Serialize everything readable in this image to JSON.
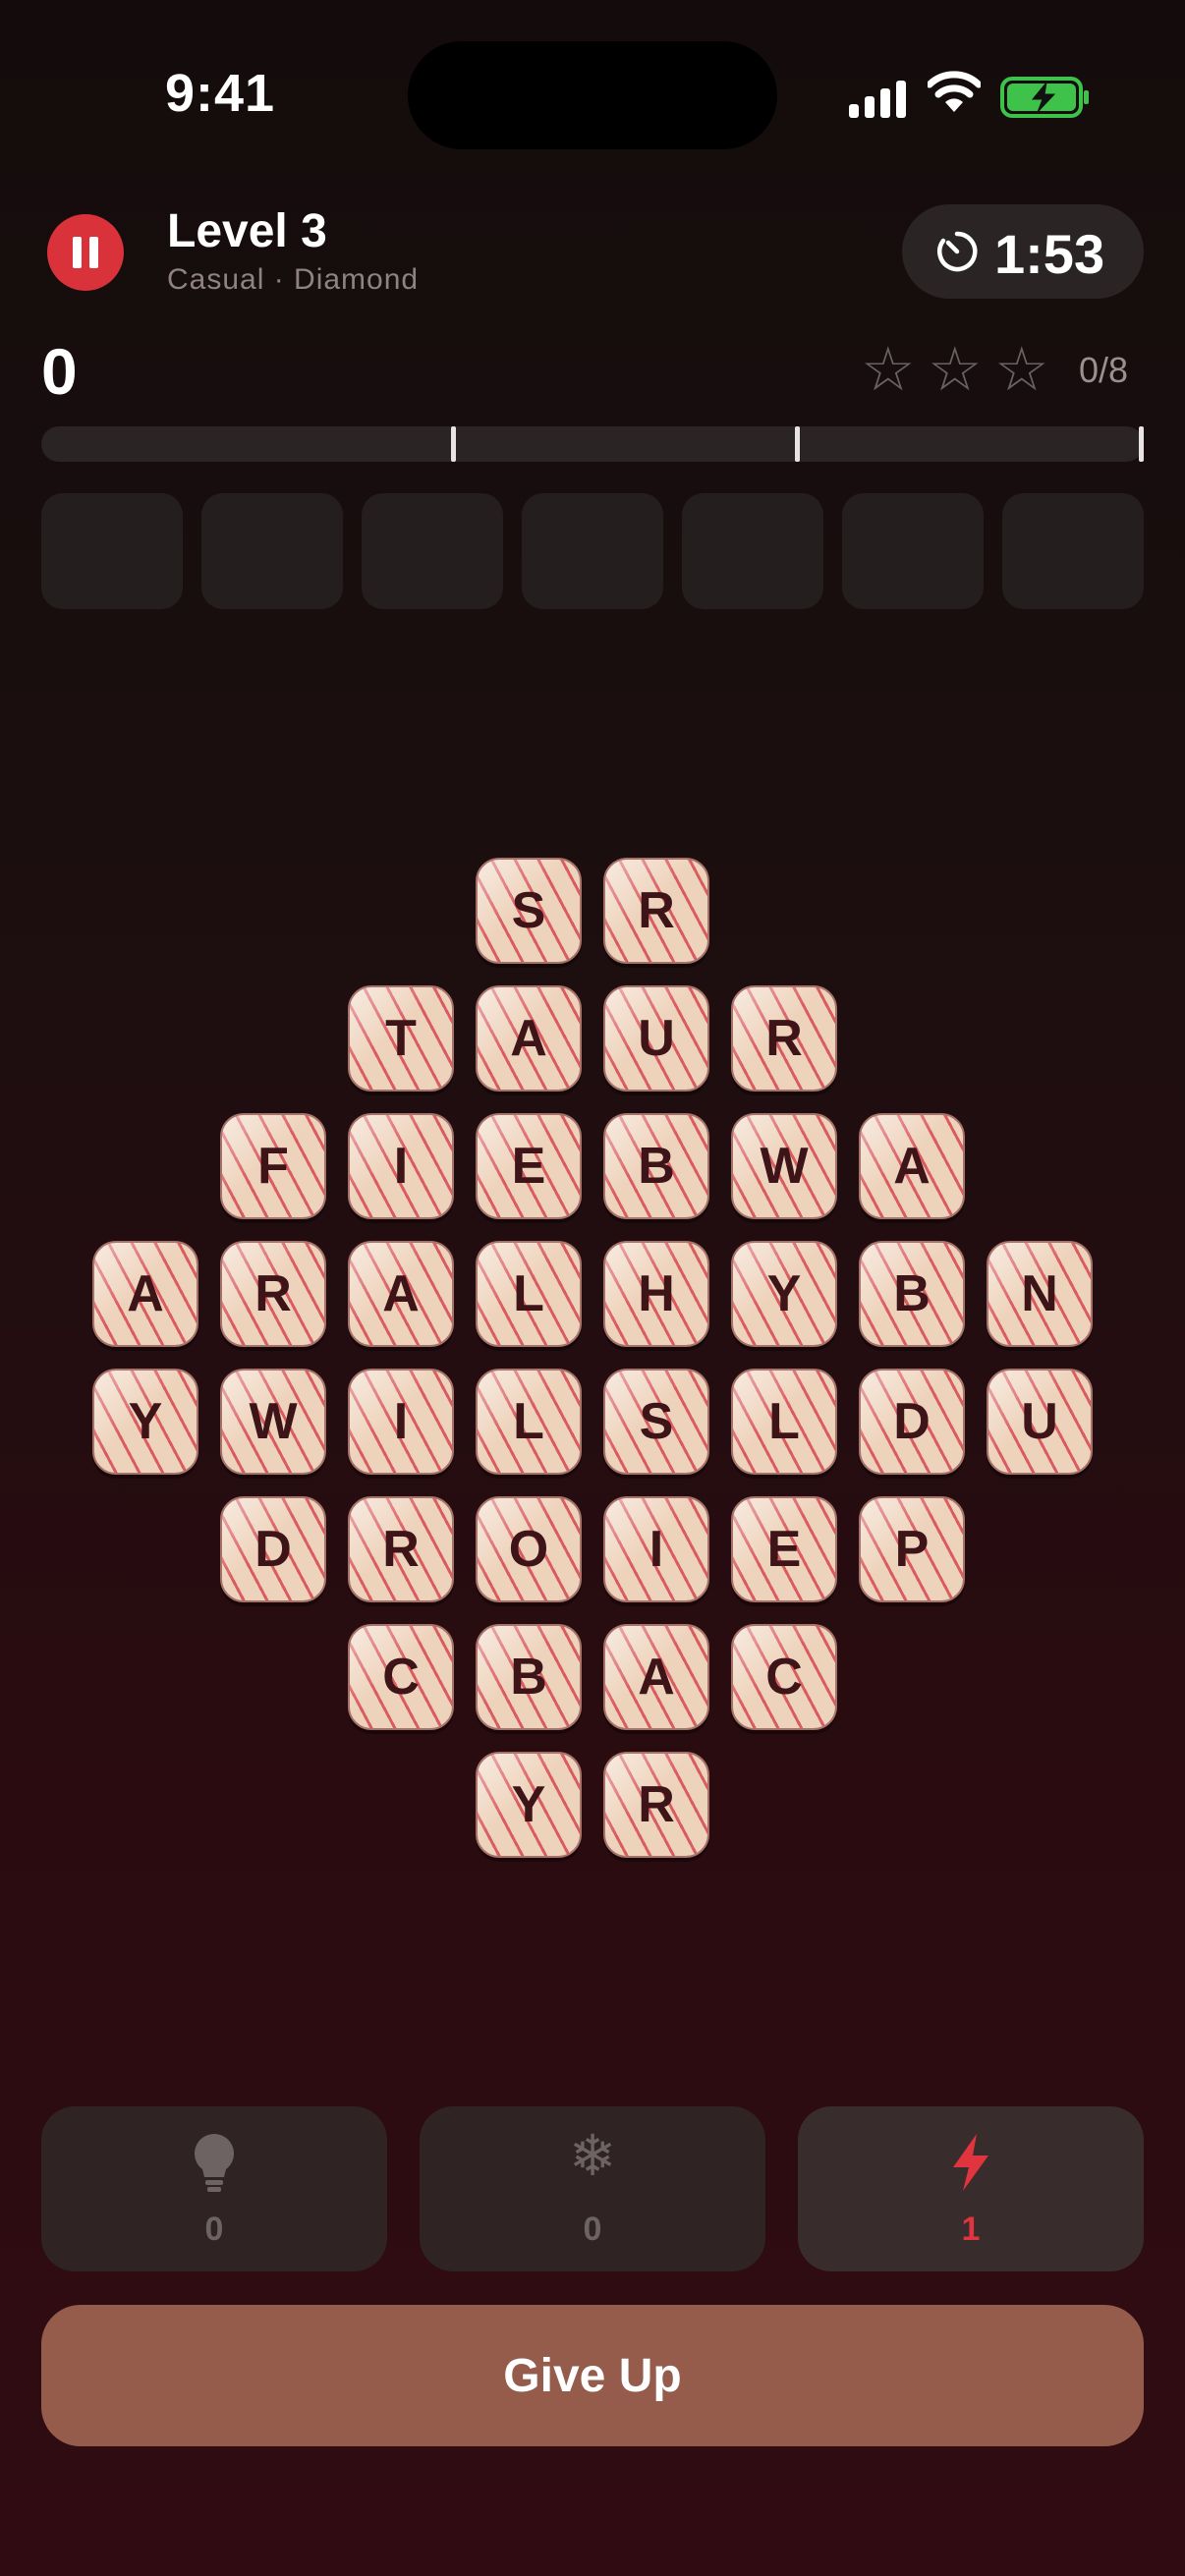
{
  "status_bar": {
    "time": "9:41"
  },
  "header": {
    "level_title": "Level 3",
    "subtitle": "Casual · Diamond",
    "timer": "1:53",
    "score": "0",
    "stars_count": "0/8",
    "stars_earned": 0,
    "stars_total": 3
  },
  "progress": {
    "value": 0
  },
  "word_slots": 7,
  "board": {
    "rows": [
      [
        "S",
        "R"
      ],
      [
        "T",
        "A",
        "U",
        "R"
      ],
      [
        "F",
        "I",
        "E",
        "B",
        "W",
        "A"
      ],
      [
        "A",
        "R",
        "A",
        "L",
        "H",
        "Y",
        "B",
        "N"
      ],
      [
        "Y",
        "W",
        "I",
        "L",
        "S",
        "L",
        "D",
        "U"
      ],
      [
        "D",
        "R",
        "O",
        "I",
        "E",
        "P"
      ],
      [
        "C",
        "B",
        "A",
        "C"
      ],
      [
        "Y",
        "R"
      ]
    ]
  },
  "powerups": {
    "hint": {
      "count": "0",
      "icon": "lightbulb-icon"
    },
    "freeze": {
      "count": "0",
      "icon": "snowflake-icon"
    },
    "bolt": {
      "count": "1",
      "icon": "lightning-icon",
      "color": "#e0343e"
    }
  },
  "give_up_label": "Give Up",
  "colors": {
    "accent": "#d9323a",
    "tile": "#eed3bc",
    "give_up": "#955b4b"
  }
}
